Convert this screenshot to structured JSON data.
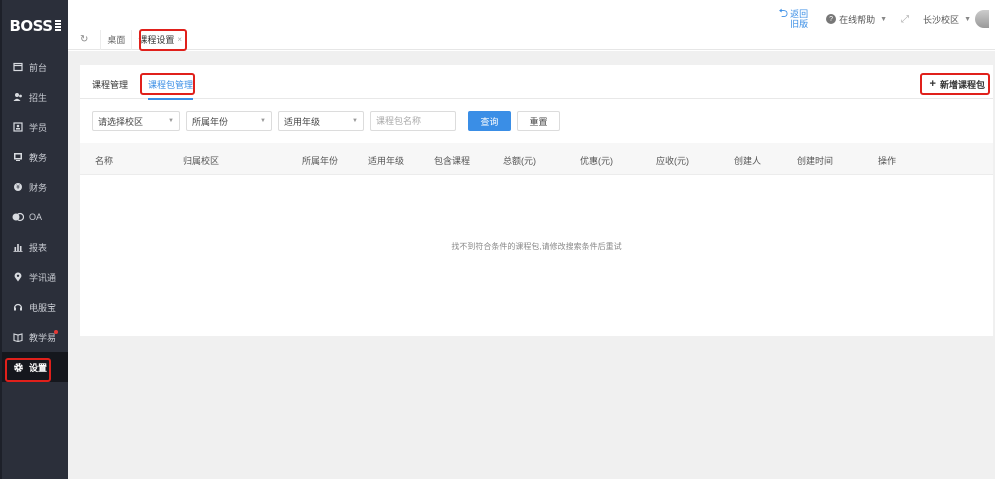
{
  "sidebar": {
    "logo": "BOSS",
    "items": [
      {
        "label": "前台",
        "icon": "calendar-icon"
      },
      {
        "label": "招生",
        "icon": "people-icon"
      },
      {
        "label": "学员",
        "icon": "id-card-icon"
      },
      {
        "label": "教务",
        "icon": "board-icon"
      },
      {
        "label": "财务",
        "icon": "money-icon"
      },
      {
        "label": "OA",
        "icon": "toggle-icon"
      },
      {
        "label": "报表",
        "icon": "bar-chart-icon"
      },
      {
        "label": "学讯通",
        "icon": "pin-icon"
      },
      {
        "label": "电服宝",
        "icon": "headset-icon"
      },
      {
        "label": "教学易",
        "icon": "book-icon"
      },
      {
        "label": "设置",
        "icon": "gear-icon"
      }
    ]
  },
  "header": {
    "back_label": "返回旧版",
    "help_label": "在线帮助",
    "campus_label": "长沙校区"
  },
  "page_tabs": [
    {
      "label": "桌面"
    },
    {
      "label": "课程设置",
      "close": "×"
    }
  ],
  "subtabs": [
    {
      "label": "课程管理"
    },
    {
      "label": "课程包管理"
    }
  ],
  "add_button_label": "新增课程包",
  "filters": {
    "campus": "请选择校区",
    "year": "所属年份",
    "grade": "适用年级",
    "name_placeholder": "课程包名称",
    "query_label": "查询",
    "reset_label": "重置"
  },
  "table": {
    "columns": [
      "名称",
      "归属校区",
      "所属年份",
      "适用年级",
      "包含课程",
      "总额(元)",
      "优惠(元)",
      "应收(元)",
      "创建人",
      "创建时间",
      "操作"
    ],
    "empty_message": "找不到符合条件的课程包,请修改搜索条件后重试"
  }
}
